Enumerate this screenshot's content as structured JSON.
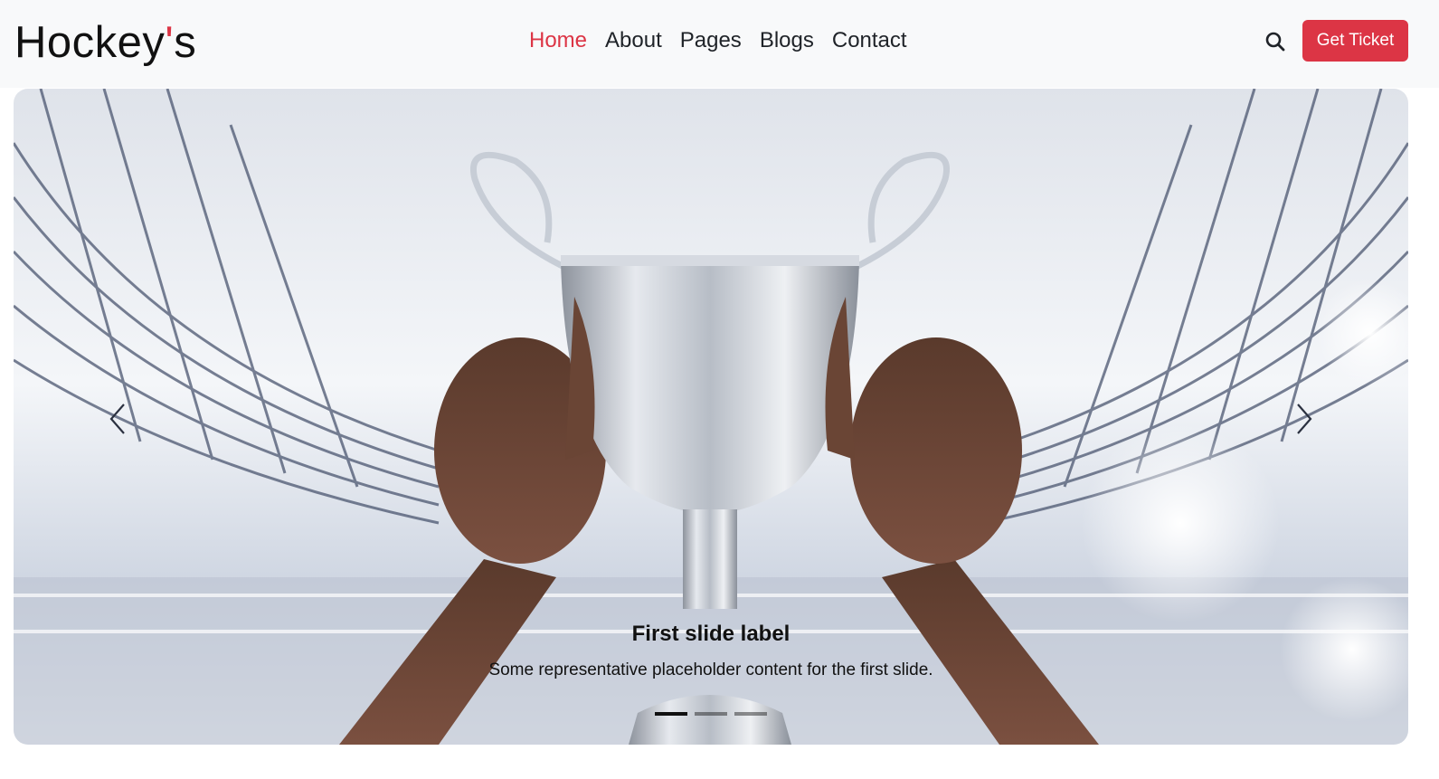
{
  "brand": {
    "name_start": "Hockey",
    "name_accent": "'",
    "name_end": "s"
  },
  "nav": {
    "links": [
      {
        "label": "Home",
        "active": true
      },
      {
        "label": "About",
        "active": false
      },
      {
        "label": "Pages",
        "active": false
      },
      {
        "label": "Blogs",
        "active": false
      },
      {
        "label": "Contact",
        "active": false
      }
    ],
    "search_icon": "search-icon",
    "ticket_button": "Get Ticket"
  },
  "carousel": {
    "slide_title": "First slide label",
    "slide_text": "Some representative placeholder content for the first slide.",
    "prev_icon": "chevron-left-icon",
    "next_icon": "chevron-right-icon",
    "indicators": [
      {
        "active": true
      },
      {
        "active": false
      },
      {
        "active": false
      }
    ],
    "image_subject": "trophy-held-in-stadium"
  },
  "colors": {
    "accent": "#dc3545",
    "navbar_bg": "#f8f9fa",
    "text": "#1f2328"
  }
}
